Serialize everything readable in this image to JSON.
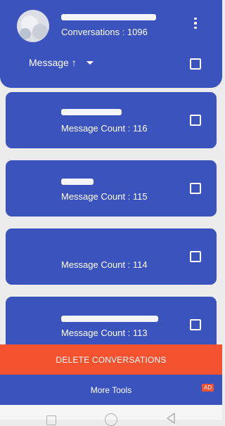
{
  "header": {
    "conversations_text": "Conversations : 1096",
    "sort_label": "Message ↑",
    "avatar_icon": "avatar",
    "menu_icon": "more-vertical-icon"
  },
  "cards": [
    {
      "count_text": "Message Count : 116"
    },
    {
      "count_text": "Message Count : 115"
    },
    {
      "count_text": "Message Count : 114"
    },
    {
      "count_text": "Message Count : 113"
    }
  ],
  "actions": {
    "delete_label": "DELETE CONVERSATIONS",
    "more_tools_label": "More Tools",
    "ad_badge": "AD"
  },
  "colors": {
    "primary": "#3b53bd",
    "danger": "#f5522f",
    "background": "#ececec"
  }
}
